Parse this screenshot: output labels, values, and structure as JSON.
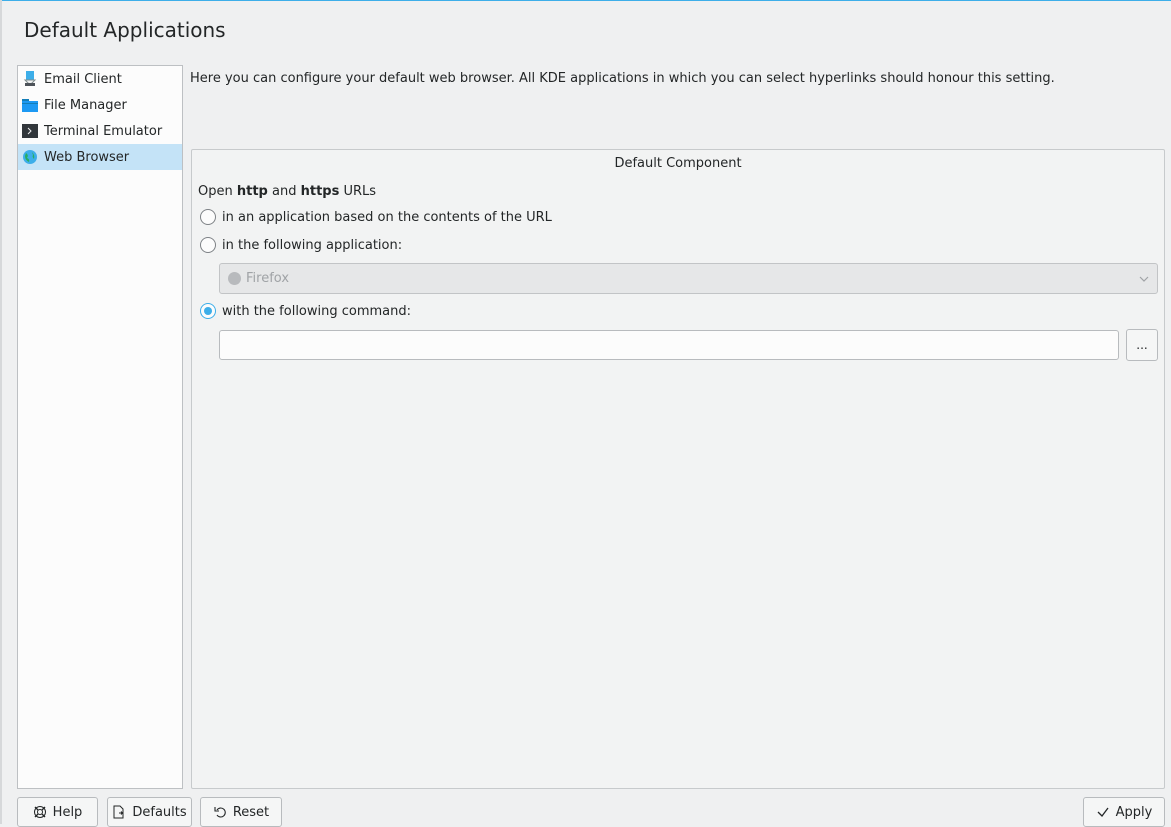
{
  "page": {
    "title": "Default Applications"
  },
  "sidebar": {
    "items": [
      {
        "label": "Email Client",
        "icon": "email-client-icon",
        "selected": false
      },
      {
        "label": "File Manager",
        "icon": "folder-icon",
        "selected": false
      },
      {
        "label": "Terminal Emulator",
        "icon": "terminal-icon",
        "selected": false
      },
      {
        "label": "Web Browser",
        "icon": "globe-icon",
        "selected": true
      }
    ]
  },
  "main": {
    "description": "Here you can configure your default web browser. All KDE applications in which you can select hyperlinks should honour this setting.",
    "group_title": "Default Component",
    "open_label": {
      "prefix": "Open ",
      "http": "http",
      "and": " and ",
      "https": "https",
      "suffix": " URLs"
    },
    "options": [
      {
        "label": "in an application based on the contents of the URL",
        "checked": false
      },
      {
        "label": "in the following application:",
        "checked": false
      },
      {
        "label": "with the following command:",
        "checked": true
      }
    ],
    "application_select": {
      "value": "Firefox",
      "disabled": true
    },
    "command_input": {
      "value": "",
      "placeholder": ""
    },
    "browse_label": "..."
  },
  "footer": {
    "help_label": "Help",
    "defaults_label": "Defaults",
    "reset_label": "Reset",
    "apply_label": "Apply"
  },
  "colors": {
    "accent": "#3daee9",
    "selection": "#c4e3f7",
    "window": "#eff0f1"
  }
}
